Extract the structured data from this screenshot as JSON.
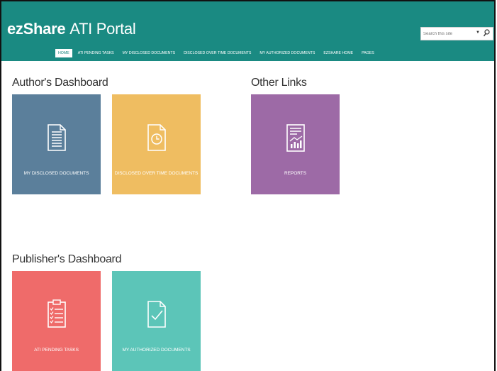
{
  "header": {
    "logo": "ezShare",
    "site_title": "ATI Portal",
    "search_placeholder": "Search this site",
    "background_color": "#1a8a82"
  },
  "nav": {
    "items": [
      {
        "label": "HOME",
        "active": true
      },
      {
        "label": "ATI PENDING TASKS"
      },
      {
        "label": "MY DISCLOSED DOCUMENTS"
      },
      {
        "label": "DISCLOSED OVER TIME DOCUMENTS"
      },
      {
        "label": "MY AUTHORIZED DOCUMENTS"
      },
      {
        "label": "EZSHARE HOME"
      },
      {
        "label": "PAGES"
      }
    ]
  },
  "authors_dashboard": {
    "title": "Author's Dashboard",
    "tiles": [
      {
        "label": "MY DISCLOSED DOCUMENTS",
        "icon": "document-icon",
        "color": "#5b7f9b"
      },
      {
        "label": "DISCLOSED OVER TIME DOCUMENTS",
        "icon": "clock-document-icon",
        "color": "#efbd61"
      }
    ]
  },
  "other_links": {
    "title": "Other Links",
    "tiles": [
      {
        "label": "REPORTS",
        "icon": "report-chart-icon",
        "color": "#9d6aa6"
      }
    ]
  },
  "publishers_dashboard": {
    "title": "Publisher's Dashboard",
    "tiles": [
      {
        "label": "ATI PENDING TASKS",
        "icon": "clipboard-checklist-icon",
        "color": "#ef6b6a"
      },
      {
        "label": "MY AUTHORIZED DOCUMENTS",
        "icon": "checked-document-icon",
        "color": "#5cc5b8"
      }
    ]
  }
}
